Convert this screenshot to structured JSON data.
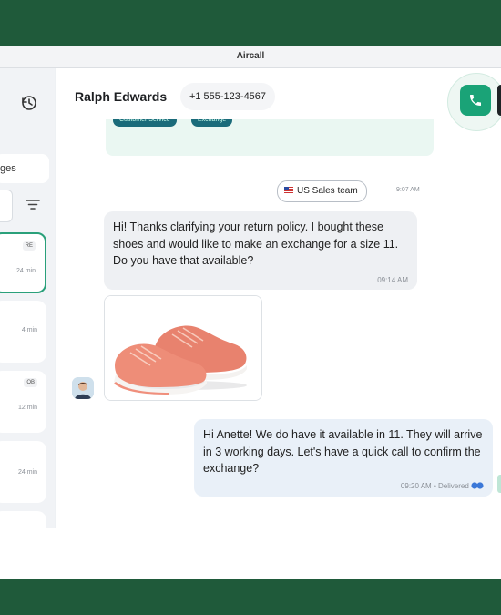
{
  "window": {
    "title": "Aircall"
  },
  "sidebar": {
    "tab_label": "ges",
    "cards": [
      {
        "tag": "RE",
        "time": "24 min"
      },
      {
        "tag": "",
        "time": "4 min"
      },
      {
        "tag": "OB",
        "time": "12 min"
      },
      {
        "tag": "",
        "time": "24 min"
      }
    ]
  },
  "header": {
    "contact_name": "Ralph Edwards",
    "phone": "+1 555-123-4567"
  },
  "previous_message": {
    "chips": [
      "Customer Service",
      "Exchange"
    ],
    "team": "US Sales team",
    "time": "9:07 AM"
  },
  "messages": {
    "incoming": {
      "text": "Hi! Thanks clarifying your return policy. I bought these shoes and would like to make an exchange for a size 11. Do you have that available?",
      "time": "09:14 AM"
    },
    "outgoing": {
      "text": "Hi Anette! We do have it available in 11. They will arrive in 3 working days. Let's have a quick call to confirm the exchange?",
      "meta": "09:20 AM • Delivered"
    }
  },
  "colors": {
    "brand_green": "#1f5a3a",
    "call_green": "#1aa377",
    "selected_border": "#2aa07a"
  },
  "icons": [
    "history-icon",
    "filter-icon",
    "phone-icon",
    "delivered-icon",
    "us-flag-icon"
  ]
}
